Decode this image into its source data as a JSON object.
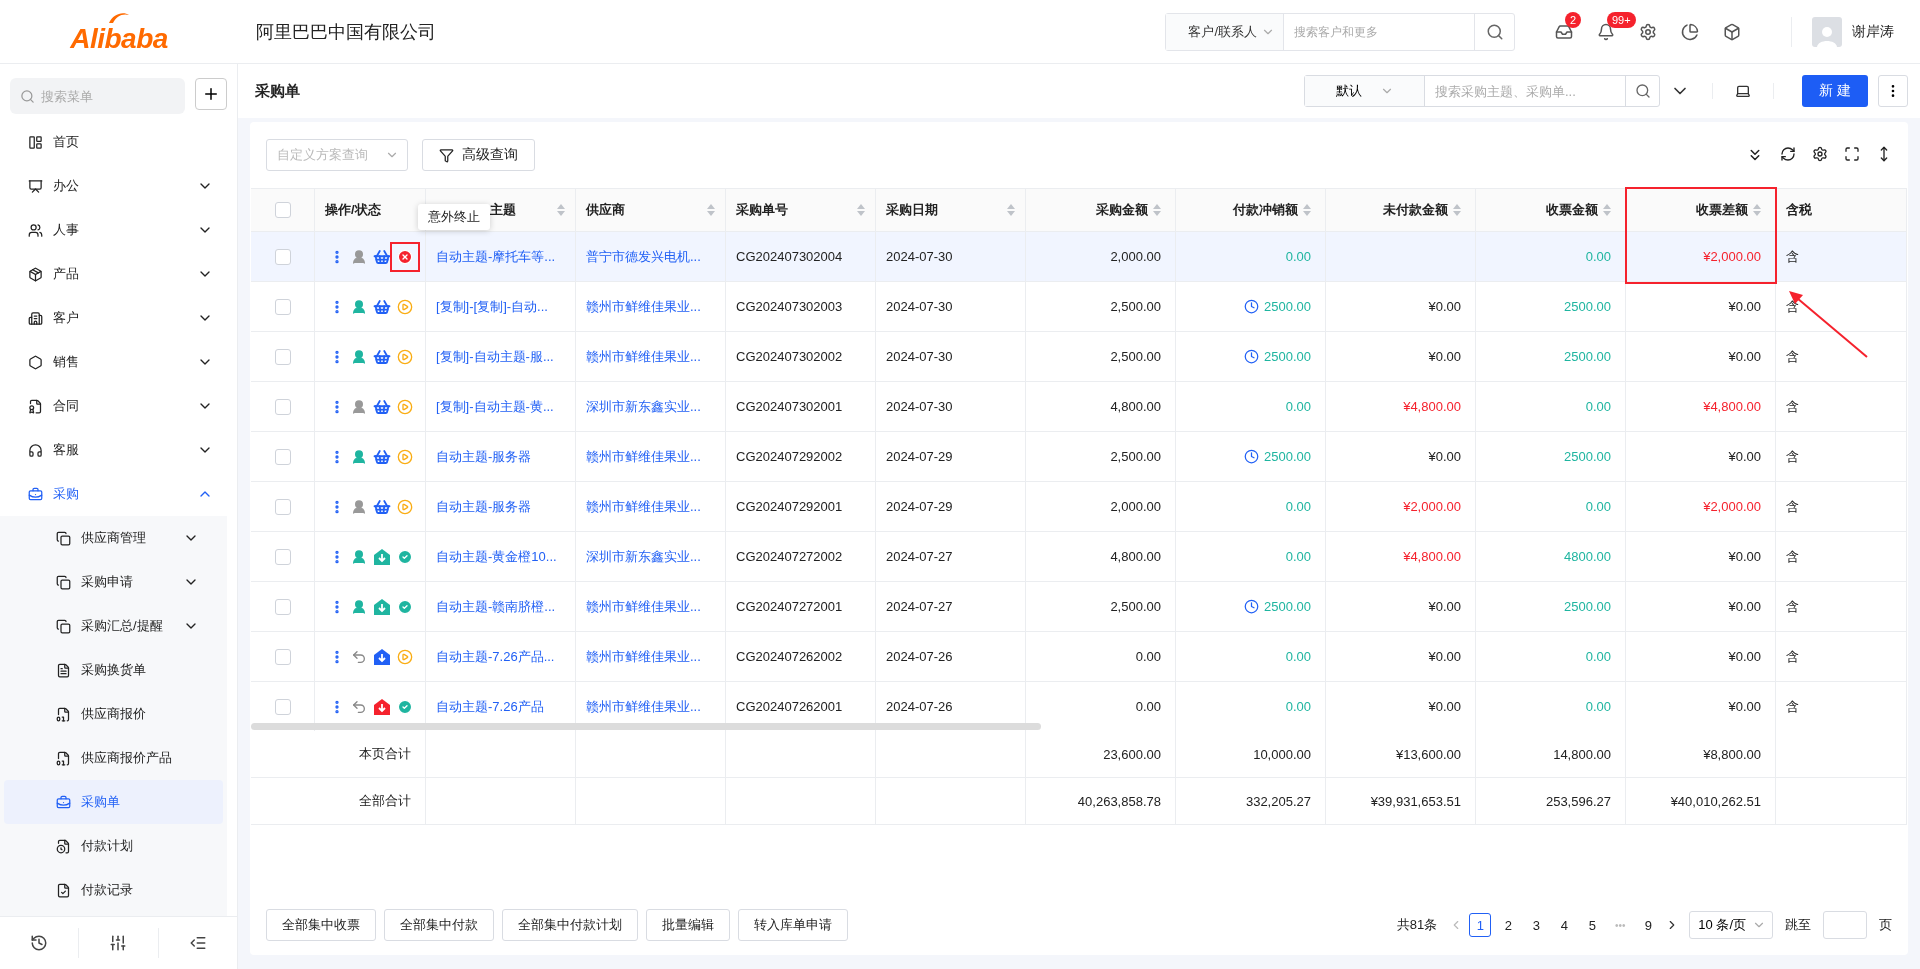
{
  "header": {
    "logo": "Alibaba",
    "company": "阿里巴巴中国有限公司",
    "search_scope": "客户/联系人",
    "search_placeholder": "搜索客户和更多",
    "icons": [
      {
        "kind": "inbox",
        "badge": "2"
      },
      {
        "kind": "bell",
        "badge": "99+"
      },
      {
        "kind": "settings"
      },
      {
        "kind": "chart"
      },
      {
        "kind": "cube"
      }
    ],
    "user": "谢岸涛"
  },
  "sidebar": {
    "search_placeholder": "搜索菜单",
    "items": [
      {
        "label": "首页",
        "kind": "home"
      },
      {
        "label": "办公",
        "kind": "office",
        "expanded": false
      },
      {
        "label": "人事",
        "kind": "people",
        "expanded": false
      },
      {
        "label": "产品",
        "kind": "product",
        "expanded": false
      },
      {
        "label": "客户",
        "kind": "customer",
        "expanded": false
      },
      {
        "label": "销售",
        "kind": "sales",
        "expanded": false
      },
      {
        "label": "合同",
        "kind": "contract",
        "expanded": false
      },
      {
        "label": "客服",
        "kind": "service",
        "expanded": false
      },
      {
        "label": "采购",
        "kind": "purchase",
        "expanded": true,
        "children": [
          {
            "label": "供应商管理",
            "kind": "stack",
            "expanded": false,
            "selected": false
          },
          {
            "label": "采购申请",
            "kind": "stack",
            "expanded": false,
            "selected": false
          },
          {
            "label": "采购汇总/提醒",
            "kind": "stack",
            "expanded": false,
            "selected": false
          },
          {
            "label": "采购换货单",
            "kind": "exchange",
            "selected": false
          },
          {
            "label": "供应商报价",
            "kind": "quote",
            "selected": false
          },
          {
            "label": "供应商报价产品",
            "kind": "quote",
            "selected": false
          },
          {
            "label": "采购单",
            "kind": "purchase",
            "selected": true
          },
          {
            "label": "付款计划",
            "kind": "plan",
            "selected": false
          },
          {
            "label": "付款记录",
            "kind": "record",
            "selected": false
          }
        ]
      }
    ]
  },
  "page": {
    "title": "采购单",
    "view": "默认",
    "search_placeholder": "搜索采购主题、采购单...",
    "new_button": "新 建"
  },
  "toolbar": {
    "scheme_placeholder": "自定义方案查询",
    "advanced": "高级查询"
  },
  "table": {
    "select_all": {
      "checked": false
    },
    "columns": [
      {
        "label": "操作/状态",
        "sortable": false
      },
      {
        "label": "主题",
        "sortable": true
      },
      {
        "label": "供应商",
        "sortable": true
      },
      {
        "label": "采购单号",
        "sortable": true
      },
      {
        "label": "采购日期",
        "sortable": true
      },
      {
        "label": "采购金额",
        "sortable": true
      },
      {
        "label": "付款冲销额",
        "sortable": true
      },
      {
        "label": "未付款金额",
        "sortable": true
      },
      {
        "label": "收票金额",
        "sortable": true
      },
      {
        "label": "收票差额",
        "sortable": true,
        "annotated": true
      },
      {
        "label": "含税",
        "sortable": false
      }
    ],
    "tooltip": {
      "text": "意外终止"
    },
    "rows": [
      {
        "checked": false,
        "selected": true,
        "icons": [
          {
            "kind": "person_off"
          },
          {
            "kind": "basket"
          },
          {
            "kind": "terminated",
            "annotated": true
          }
        ],
        "subject": "自动主题-摩托车等...",
        "supplier": "普宁市德发兴电机...",
        "number": "CG202407302004",
        "date": "2024-07-30",
        "amount": "2,000.00",
        "offset": {
          "text": "0.00",
          "scheduled": false
        },
        "invoiced": "0.00",
        "diff": {
          "text": "¥2,000.00",
          "alert": true
        },
        "tax": "含"
      },
      {
        "checked": false,
        "selected": false,
        "icons": [
          {
            "kind": "person_on"
          },
          {
            "kind": "basket"
          },
          {
            "kind": "pending"
          }
        ],
        "subject": "[复制]-[复制]-自动...",
        "supplier": "赣州市鲜维佳果业...",
        "number": "CG202407302003",
        "date": "2024-07-30",
        "amount": "2,500.00",
        "offset": {
          "text": "2500.00",
          "scheduled": true
        },
        "unpaid": {
          "text": "¥0.00",
          "alert": false
        },
        "invoiced": "2500.00",
        "diff": {
          "text": "¥0.00",
          "alert": false
        },
        "tax": "含"
      },
      {
        "checked": false,
        "selected": false,
        "icons": [
          {
            "kind": "person_on"
          },
          {
            "kind": "basket"
          },
          {
            "kind": "pending"
          }
        ],
        "subject": "[复制]-自动主题-服...",
        "supplier": "赣州市鲜维佳果业...",
        "number": "CG202407302002",
        "date": "2024-07-30",
        "amount": "2,500.00",
        "offset": {
          "text": "2500.00",
          "scheduled": true
        },
        "unpaid": {
          "text": "¥0.00",
          "alert": false
        },
        "invoiced": "2500.00",
        "diff": {
          "text": "¥0.00",
          "alert": false
        },
        "tax": "含"
      },
      {
        "checked": false,
        "selected": false,
        "icons": [
          {
            "kind": "person_off"
          },
          {
            "kind": "basket"
          },
          {
            "kind": "pending"
          }
        ],
        "subject": "[复制]-自动主题-黄...",
        "supplier": "深圳市新东鑫实业...",
        "number": "CG202407302001",
        "date": "2024-07-30",
        "amount": "4,800.00",
        "offset": {
          "text": "0.00",
          "scheduled": false
        },
        "unpaid": {
          "text": "¥4,800.00",
          "alert": true
        },
        "invoiced": "0.00",
        "diff": {
          "text": "¥4,800.00",
          "alert": true
        },
        "tax": "含"
      },
      {
        "checked": false,
        "selected": false,
        "icons": [
          {
            "kind": "person_on"
          },
          {
            "kind": "basket"
          },
          {
            "kind": "pending"
          }
        ],
        "subject": "自动主题-服务器",
        "supplier": "赣州市鲜维佳果业...",
        "number": "CG202407292002",
        "date": "2024-07-29",
        "amount": "2,500.00",
        "offset": {
          "text": "2500.00",
          "scheduled": true
        },
        "unpaid": {
          "text": "¥0.00",
          "alert": false
        },
        "invoiced": "2500.00",
        "diff": {
          "text": "¥0.00",
          "alert": false
        },
        "tax": "含"
      },
      {
        "checked": false,
        "selected": false,
        "icons": [
          {
            "kind": "person_off"
          },
          {
            "kind": "basket"
          },
          {
            "kind": "pending"
          }
        ],
        "subject": "自动主题-服务器",
        "supplier": "赣州市鲜维佳果业...",
        "number": "CG202407292001",
        "date": "2024-07-29",
        "amount": "2,000.00",
        "offset": {
          "text": "0.00",
          "scheduled": false
        },
        "unpaid": {
          "text": "¥2,000.00",
          "alert": true
        },
        "invoiced": "0.00",
        "diff": {
          "text": "¥2,000.00",
          "alert": true
        },
        "tax": "含"
      },
      {
        "checked": false,
        "selected": false,
        "icons": [
          {
            "kind": "person_on"
          },
          {
            "kind": "inbound_done"
          },
          {
            "kind": "completed"
          }
        ],
        "subject": "自动主题-黄金橙10...",
        "supplier": "深圳市新东鑫实业...",
        "number": "CG202407272002",
        "date": "2024-07-27",
        "amount": "4,800.00",
        "offset": {
          "text": "0.00",
          "scheduled": false
        },
        "unpaid": {
          "text": "¥4,800.00",
          "alert": true
        },
        "invoiced": "4800.00",
        "diff": {
          "text": "¥0.00",
          "alert": false
        },
        "tax": "含"
      },
      {
        "checked": false,
        "selected": false,
        "icons": [
          {
            "kind": "person_on"
          },
          {
            "kind": "inbound_done"
          },
          {
            "kind": "completed"
          }
        ],
        "subject": "自动主题-赣南脐橙...",
        "supplier": "赣州市鲜维佳果业...",
        "number": "CG202407272001",
        "date": "2024-07-27",
        "amount": "2,500.00",
        "offset": {
          "text": "2500.00",
          "scheduled": true
        },
        "unpaid": {
          "text": "¥0.00",
          "alert": false
        },
        "invoiced": "2500.00",
        "diff": {
          "text": "¥0.00",
          "alert": false
        },
        "tax": "含"
      },
      {
        "checked": false,
        "selected": false,
        "icons": [
          {
            "kind": "returned"
          },
          {
            "kind": "inbound_partial"
          },
          {
            "kind": "pending"
          }
        ],
        "subject": "自动主题-7.26产品...",
        "supplier": "赣州市鲜维佳果业...",
        "number": "CG202407262002",
        "date": "2024-07-26",
        "amount": "0.00",
        "offset": {
          "text": "0.00",
          "scheduled": false
        },
        "unpaid": {
          "text": "¥0.00",
          "alert": false
        },
        "invoiced": "0.00",
        "diff": {
          "text": "¥0.00",
          "alert": false
        },
        "tax": "含"
      },
      {
        "checked": false,
        "selected": false,
        "icons": [
          {
            "kind": "returned"
          },
          {
            "kind": "inbound_error"
          },
          {
            "kind": "completed"
          }
        ],
        "subject": "自动主题-7.26产品",
        "supplier": "赣州市鲜维佳果业...",
        "number": "CG202407262001",
        "date": "2024-07-26",
        "amount": "0.00",
        "offset": {
          "text": "0.00",
          "scheduled": false
        },
        "unpaid": {
          "text": "¥0.00",
          "alert": false
        },
        "invoiced": "0.00",
        "diff": {
          "text": "¥0.00",
          "alert": false
        },
        "tax": "含"
      }
    ],
    "totals": [
      {
        "label": "本页合计",
        "values": [
          "23,600.00",
          "10,000.00",
          "¥13,600.00",
          "14,800.00",
          "¥8,800.00"
        ]
      },
      {
        "label": "全部合计",
        "values": [
          "40,263,858.78",
          "332,205.27",
          "¥39,931,653.51",
          "253,596.27",
          "¥40,010,262.51"
        ]
      }
    ]
  },
  "footer": {
    "buttons": [
      "全部集中收票",
      "全部集中付款",
      "全部集中付款计划",
      "批量编辑",
      "转入库单申请"
    ],
    "total": "共81条",
    "pages": [
      {
        "label": "1",
        "kind": "page",
        "selected": true
      },
      {
        "label": "2",
        "kind": "page",
        "selected": false
      },
      {
        "label": "3",
        "kind": "page",
        "selected": false
      },
      {
        "label": "4",
        "kind": "page",
        "selected": false
      },
      {
        "label": "5",
        "kind": "page",
        "selected": false
      },
      {
        "label": "•••",
        "kind": "ellipsis",
        "selected": false
      },
      {
        "label": "9",
        "kind": "page",
        "selected": false
      }
    ],
    "page_size": "10 条/页",
    "jump_label": "跳至",
    "jump_suffix": "页"
  }
}
